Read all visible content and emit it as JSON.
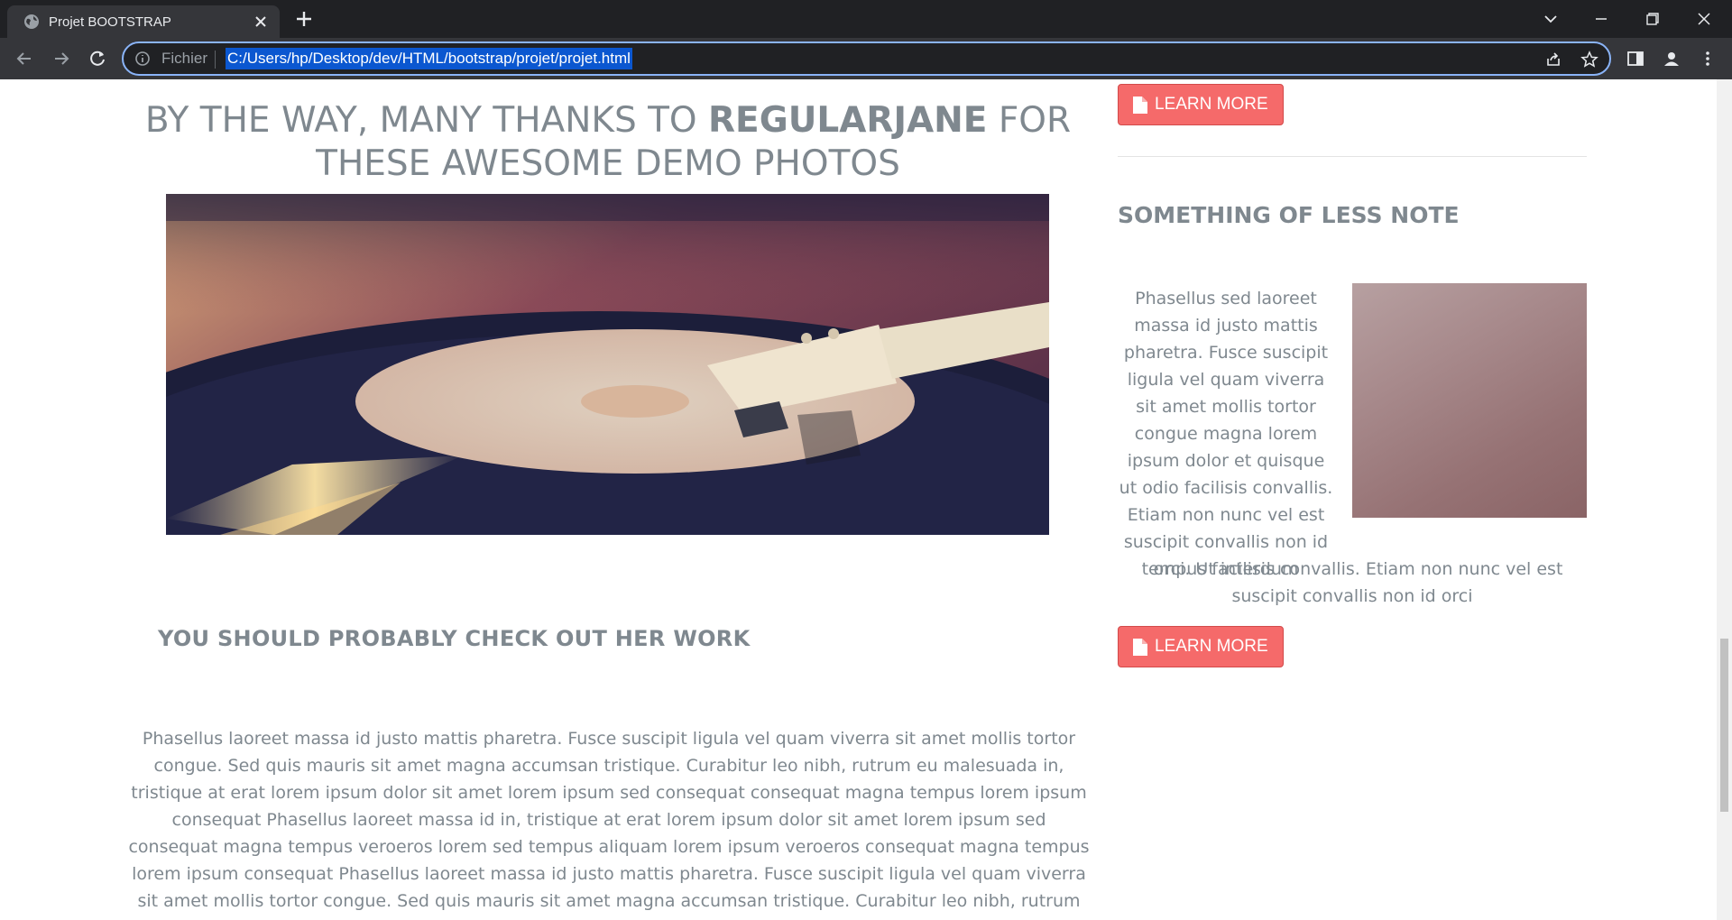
{
  "browser": {
    "tab_title": "Projet BOOTSTRAP",
    "url_scheme_label": "Fichier",
    "url": "C:/Users/hp/Desktop/dev/HTML/bootstrap/projet/projet.html"
  },
  "page": {
    "heading_part1": "BY THE WAY, MANY THANKS TO ",
    "heading_strong": "REGULARJANE",
    "heading_part2": " FOR THESE AWESOME DEMO PHOTOS",
    "subheading": "YOU SHOULD PROBABLY CHECK OUT HER WORK",
    "body": "Phasellus laoreet massa id justo mattis pharetra. Fusce suscipit ligula vel quam viverra sit amet mollis tortor congue. Sed quis mauris sit amet magna accumsan tristique. Curabitur leo nibh, rutrum eu malesuada in, tristique at erat lorem ipsum dolor sit amet lorem ipsum sed consequat consequat magna tempus lorem ipsum consequat Phasellus laoreet massa id in, tristique at erat lorem ipsum dolor sit amet lorem ipsum sed consequat magna tempus veroeros lorem sed tempus aliquam lorem ipsum veroeros consequat magna tempus lorem ipsum consequat Phasellus laoreet massa id justo mattis pharetra. Fusce suscipit ligula vel quam viverra sit amet mollis tortor congue. Sed quis mauris sit amet magna accumsan tristique. Curabitur leo nibh, rutrum malesuada."
  },
  "sidebar": {
    "learn_more_top": "LEARN MORE",
    "heading": "SOMETHING OF LESS NOTE",
    "text_wrapped": "Phasellus sed laoreet massa id justo mattis pharetra. Fusce suscipit ligula vel quam viverra sit amet mollis tortor congue magna lorem ipsum dolor et quisque ut odio facilisis convallis. Etiam non nunc vel est suscipit convallis non id orci. Ut interdum",
    "text_full": "tempus facilisis convallis. Etiam non nunc vel est suscipit convallis non id orci",
    "learn_more_bottom": "LEARN MORE"
  },
  "colors": {
    "accent": "#f56a6a",
    "text": "#7f888f",
    "chrome_dark": "#202124",
    "chrome_toolbar": "#35363a",
    "focus": "#8ab4f8"
  }
}
